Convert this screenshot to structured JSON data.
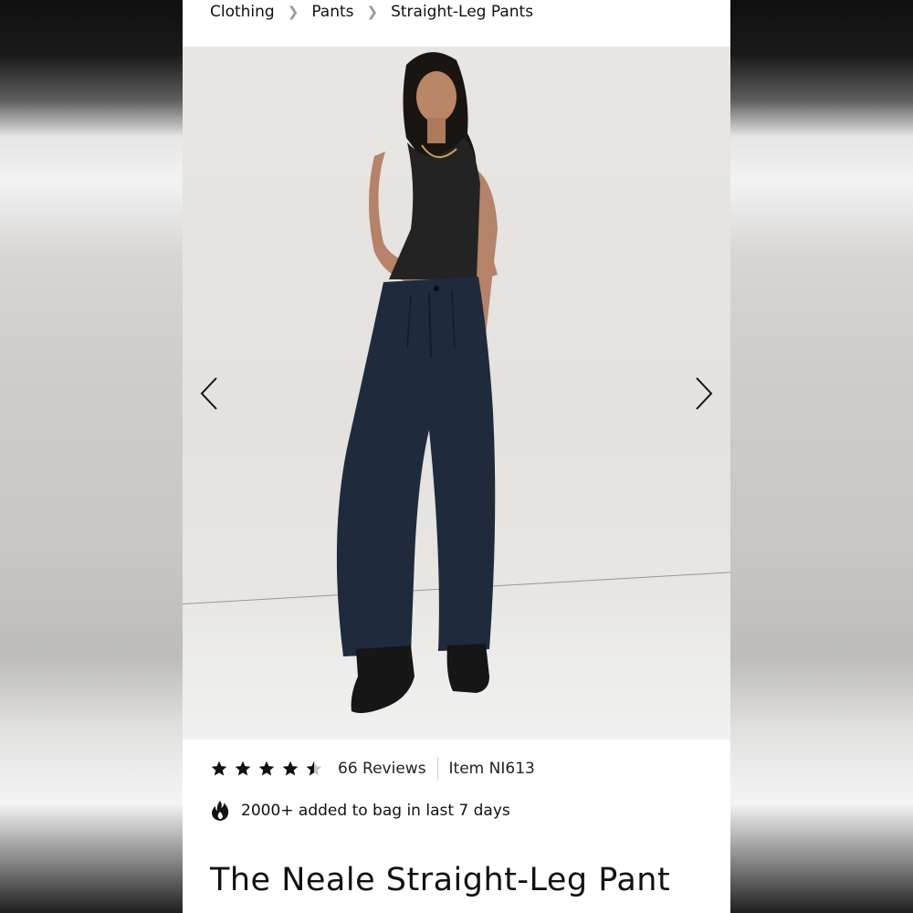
{
  "breadcrumb": {
    "items": [
      "Clothing",
      "Pants",
      "Straight-Leg Pants"
    ]
  },
  "gallery": {
    "prev_icon": "chevron-left-icon",
    "next_icon": "chevron-right-icon"
  },
  "rating": {
    "stars": 4.5,
    "reviews_label": "66 Reviews",
    "item_label": "Item NI613"
  },
  "social_proof": {
    "icon": "flame-icon",
    "text": "2000+ added to bag in last 7 days"
  },
  "product": {
    "title": "The Neale Straight-Leg Pant"
  },
  "colors": {
    "pants": "#1f2a3d",
    "top": "#232323",
    "background": "#e6e3e0"
  }
}
